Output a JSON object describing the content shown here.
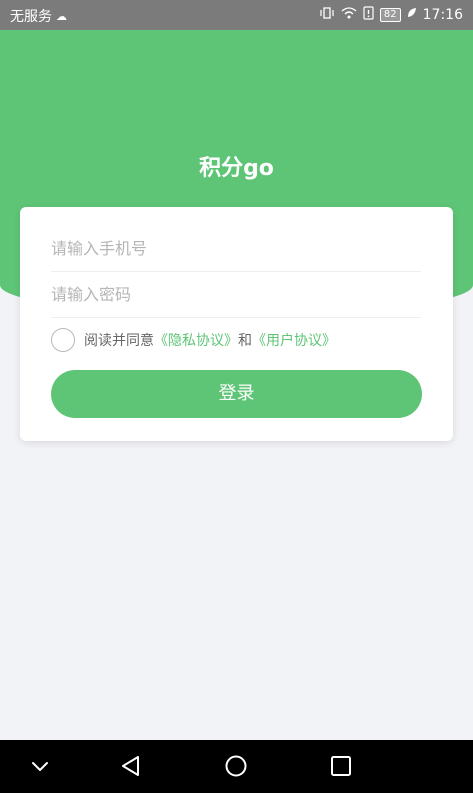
{
  "status_bar": {
    "carrier": "无服务",
    "carrier_icon": "cloud-icon",
    "battery": "82",
    "time": "17:16",
    "icons": [
      "vibrate-icon",
      "wifi-icon",
      "alert-icon",
      "battery-icon",
      "leaf-icon"
    ]
  },
  "app": {
    "title": "积分go"
  },
  "form": {
    "phone_placeholder": "请输入手机号",
    "password_placeholder": "请输入密码",
    "agree_prefix": "阅读并同意",
    "privacy_link": "《隐私协议》",
    "agree_and": "和",
    "user_link": "《用户协议》",
    "login_label": "登录"
  },
  "nav_bar": {
    "icons": [
      "chevron-down-icon",
      "back-triangle-icon",
      "home-circle-icon",
      "recent-square-icon"
    ]
  },
  "colors": {
    "brand_green": "#5ec576",
    "status_bar_bg": "#7b7b7b",
    "page_bg": "#f2f3f7"
  }
}
